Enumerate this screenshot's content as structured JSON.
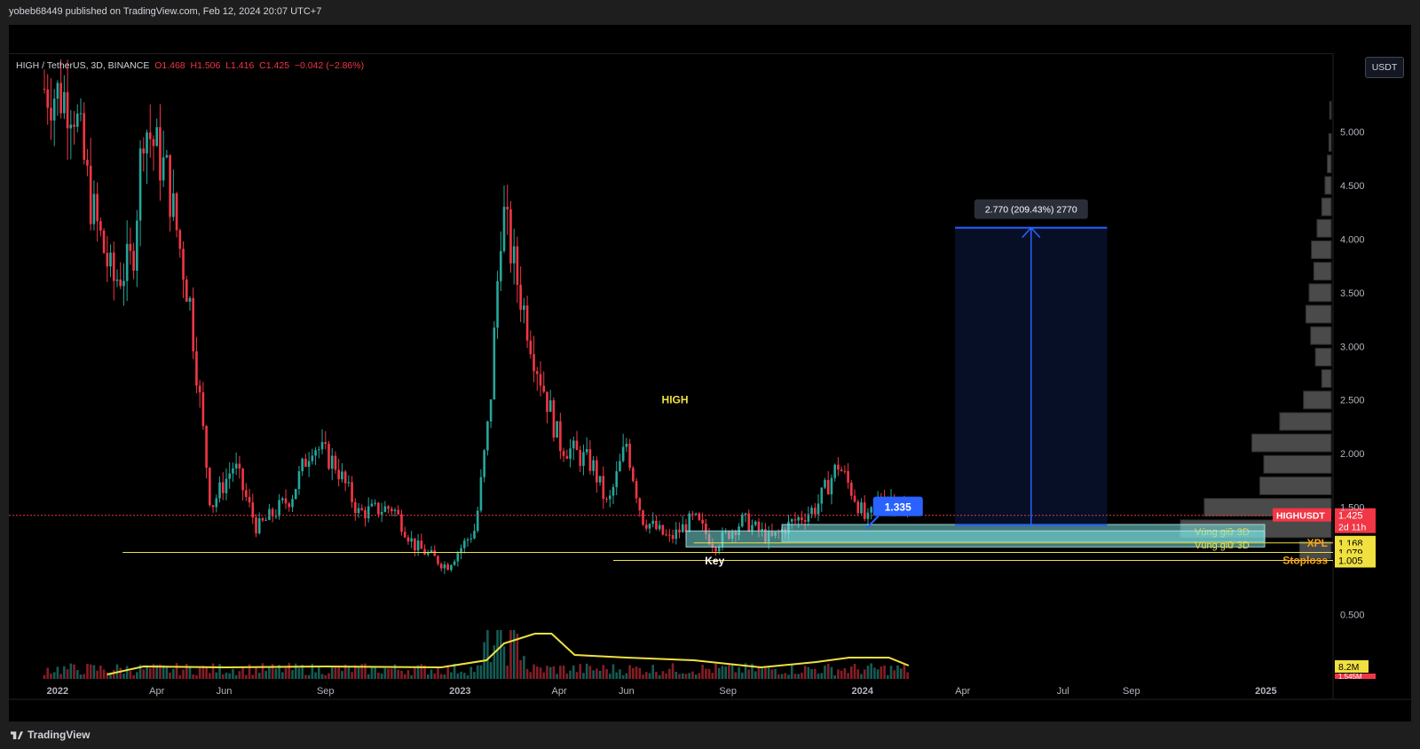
{
  "header": {
    "publisher": "yobeb68449 published on TradingView.com, Feb 12, 2024 20:07 UTC+7"
  },
  "legend": {
    "symbol": "HIGH / TetherUS, 3D, BINANCE",
    "open": "O1.468",
    "high": "H1.506",
    "low": "L1.416",
    "close": "C1.425",
    "change": "−0.042 (−2.86%)"
  },
  "currency_button": "USDT",
  "footer": {
    "brand": "TradingView"
  },
  "colors": {
    "up": "#26a69a",
    "down": "#f23645",
    "background": "#000000",
    "level_line": "#f0e040",
    "volume_ma": "#f0e040",
    "projection": "#2962ff"
  },
  "chart_data": {
    "type": "candlestick",
    "ylim": [
      0.0,
      5.5
    ],
    "y_ticks": [
      "5.000",
      "4.500",
      "4.000",
      "3.500",
      "3.000",
      "2.500",
      "2.000",
      "1.500",
      "0.500"
    ],
    "y_tick_values": [
      5.0,
      4.5,
      4.0,
      3.5,
      3.0,
      2.5,
      2.0,
      1.5,
      0.5
    ],
    "x_ticks": [
      "2022",
      "Apr",
      "Jun",
      "Sep",
      "2023",
      "Apr",
      "Jun",
      "Sep",
      "2024",
      "Apr",
      "Jul",
      "Sep",
      "2025"
    ],
    "x_tick_dates": [
      "2022-01-01",
      "2022-04-01",
      "2022-06-01",
      "2022-09-01",
      "2023-01-01",
      "2023-04-01",
      "2023-06-01",
      "2023-09-01",
      "2024-01-01",
      "2024-04-01",
      "2024-07-01",
      "2024-09-01",
      "2025-01-01"
    ],
    "price_path": [
      {
        "date": "2021-12-20",
        "close": 5.4
      },
      {
        "date": "2022-01-15",
        "close": 5.3
      },
      {
        "date": "2022-02-01",
        "close": 4.3
      },
      {
        "date": "2022-02-20",
        "close": 3.6
      },
      {
        "date": "2022-03-10",
        "close": 3.8
      },
      {
        "date": "2022-03-20",
        "close": 5.1
      },
      {
        "date": "2022-04-10",
        "close": 4.6
      },
      {
        "date": "2022-05-01",
        "close": 3.4
      },
      {
        "date": "2022-05-20",
        "close": 1.5
      },
      {
        "date": "2022-06-10",
        "close": 1.9
      },
      {
        "date": "2022-07-01",
        "close": 1.3
      },
      {
        "date": "2022-08-01",
        "close": 1.6
      },
      {
        "date": "2022-08-20",
        "close": 2.1
      },
      {
        "date": "2022-09-10",
        "close": 1.9
      },
      {
        "date": "2022-10-01",
        "close": 1.45
      },
      {
        "date": "2022-11-01",
        "close": 1.5
      },
      {
        "date": "2022-11-20",
        "close": 1.15
      },
      {
        "date": "2022-12-20",
        "close": 0.95
      },
      {
        "date": "2023-01-15",
        "close": 1.3
      },
      {
        "date": "2023-01-28",
        "close": 2.4
      },
      {
        "date": "2023-02-08",
        "close": 4.3
      },
      {
        "date": "2023-02-20",
        "close": 3.7
      },
      {
        "date": "2023-03-10",
        "close": 2.9
      },
      {
        "date": "2023-04-01",
        "close": 2.1
      },
      {
        "date": "2023-05-01",
        "close": 1.9
      },
      {
        "date": "2023-05-15",
        "close": 1.5
      },
      {
        "date": "2023-06-01",
        "close": 2.1
      },
      {
        "date": "2023-06-15",
        "close": 1.4
      },
      {
        "date": "2023-07-10",
        "close": 1.2
      },
      {
        "date": "2023-08-01",
        "close": 1.4
      },
      {
        "date": "2023-08-20",
        "close": 1.15
      },
      {
        "date": "2023-09-15",
        "close": 1.38
      },
      {
        "date": "2023-10-10",
        "close": 1.2
      },
      {
        "date": "2023-10-28",
        "close": 1.35
      },
      {
        "date": "2023-11-20",
        "close": 1.5
      },
      {
        "date": "2023-12-10",
        "close": 1.9
      },
      {
        "date": "2023-12-25",
        "close": 1.6
      },
      {
        "date": "2024-01-05",
        "close": 1.35
      },
      {
        "date": "2024-01-20",
        "close": 1.65
      },
      {
        "date": "2024-02-12",
        "close": 1.425
      }
    ],
    "last_price": {
      "value": 1.425,
      "label": "1.425",
      "symbol": "HIGHUSDT",
      "countdown": "2d 11h"
    },
    "ohlc": {
      "open": 1.468,
      "high": 1.506,
      "low": 1.416,
      "close": 1.425,
      "change": -0.042,
      "change_pct": -2.86
    },
    "levels": [
      {
        "name": "XPL",
        "value": 1.168,
        "label": "1.168"
      },
      {
        "name": "Key",
        "value": 1.079,
        "label": "1.079"
      },
      {
        "name": "Stoploss",
        "value": 1.005,
        "label": "1.005"
      }
    ],
    "zones": [
      {
        "label": "Vùng giữ 3D",
        "from": 1.18,
        "to": 1.34
      },
      {
        "label": "Vùng giữ 3D",
        "from": 1.13,
        "to": 1.28
      }
    ],
    "annotations": [
      {
        "text": "HIGH",
        "date": "2023-07-15",
        "price": 2.5
      },
      {
        "text": "1.335",
        "date": "2024-01-30",
        "price": 1.5
      },
      {
        "text": "Key",
        "date": "2023-08-20",
        "price": 1.0
      }
    ],
    "projection": {
      "label": "2.770 (209.43%) 2770",
      "from": 1.335,
      "to": 4.105,
      "start_date": "2024-03-25",
      "end_date": "2024-08-10"
    },
    "volume": {
      "ma_label": "8.2M",
      "partial_label": "1.545M"
    },
    "volume_profile": [
      {
        "price": 5.2,
        "volume": 0.02
      },
      {
        "price": 4.9,
        "volume": 0.03
      },
      {
        "price": 4.7,
        "volume": 0.05
      },
      {
        "price": 4.5,
        "volume": 0.08
      },
      {
        "price": 4.3,
        "volume": 0.12
      },
      {
        "price": 4.1,
        "volume": 0.18
      },
      {
        "price": 3.9,
        "volume": 0.25
      },
      {
        "price": 3.7,
        "volume": 0.22
      },
      {
        "price": 3.5,
        "volume": 0.28
      },
      {
        "price": 3.3,
        "volume": 0.32
      },
      {
        "price": 3.1,
        "volume": 0.26
      },
      {
        "price": 2.9,
        "volume": 0.2
      },
      {
        "price": 2.7,
        "volume": 0.12
      },
      {
        "price": 2.5,
        "volume": 0.35
      },
      {
        "price": 2.3,
        "volume": 0.65
      },
      {
        "price": 2.1,
        "volume": 1.0
      },
      {
        "price": 1.9,
        "volume": 0.85
      },
      {
        "price": 1.7,
        "volume": 0.9
      },
      {
        "price": 1.5,
        "volume": 1.6
      },
      {
        "price": 1.3,
        "volume": 1.9
      },
      {
        "price": 1.1,
        "volume": 0.4
      }
    ]
  }
}
